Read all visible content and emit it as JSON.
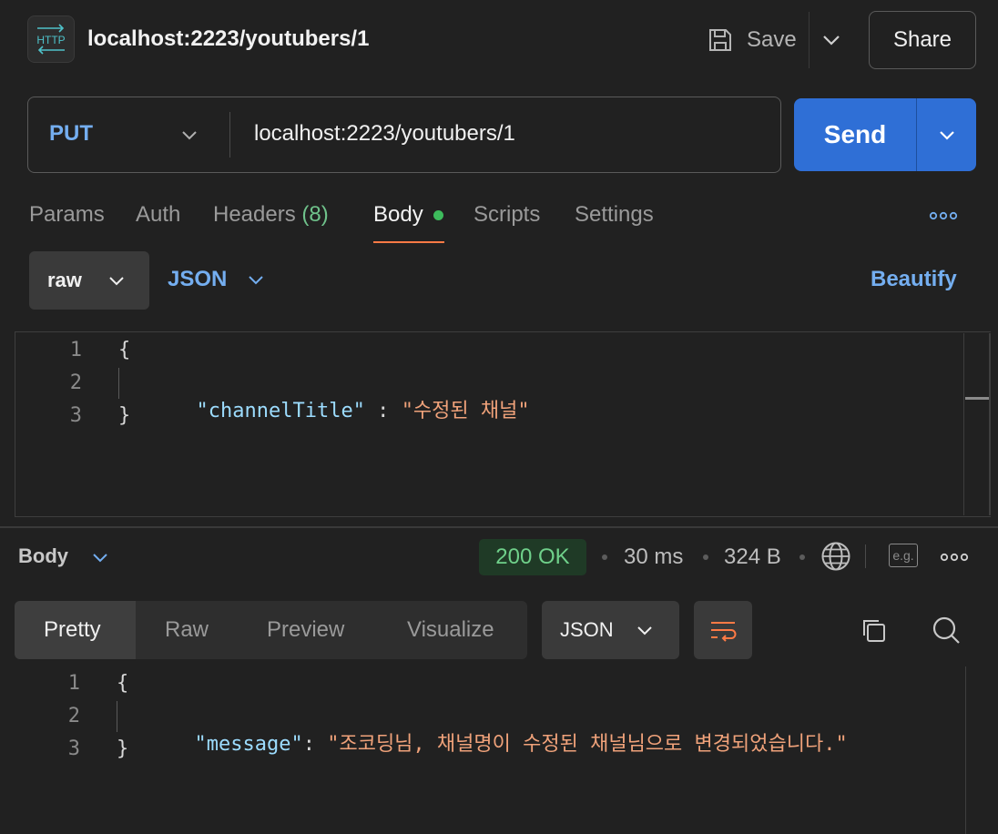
{
  "header": {
    "icon_text": "HTTP",
    "title": "localhost:2223/youtubers/1",
    "save_label": "Save",
    "share_label": "Share"
  },
  "request": {
    "method": "PUT",
    "url": "localhost:2223/youtubers/1",
    "send_label": "Send"
  },
  "request_tabs": {
    "params": "Params",
    "auth": "Auth",
    "headers": "Headers",
    "headers_count": "(8)",
    "body": "Body",
    "scripts": "Scripts",
    "settings": "Settings"
  },
  "body_options": {
    "mode": "raw",
    "language": "JSON",
    "beautify": "Beautify"
  },
  "request_body": {
    "line_numbers": [
      "1",
      "2",
      "3"
    ],
    "open_brace": "{",
    "key": "\"channelTitle\"",
    "separator": " : ",
    "value": "\"수정된 채널\"",
    "close_brace": "}"
  },
  "response": {
    "body_label": "Body",
    "status": "200 OK",
    "time": "30 ms",
    "size": "324 B",
    "eg_label": "e.g.",
    "tabs": {
      "pretty": "Pretty",
      "raw": "Raw",
      "preview": "Preview",
      "visualize": "Visualize"
    },
    "format": "JSON"
  },
  "response_body": {
    "line_numbers": [
      "1",
      "2",
      "3"
    ],
    "open_brace": "{",
    "key": "\"message\"",
    "separator": ": ",
    "value": "\"조코딩님, 채널명이 수정된 채널님으로 변경되었습니다.\"",
    "close_brace": "}"
  },
  "colors": {
    "accent_blue": "#2f6fd6",
    "status_green": "#6fd08a",
    "tab_underline": "#ff7a45"
  }
}
